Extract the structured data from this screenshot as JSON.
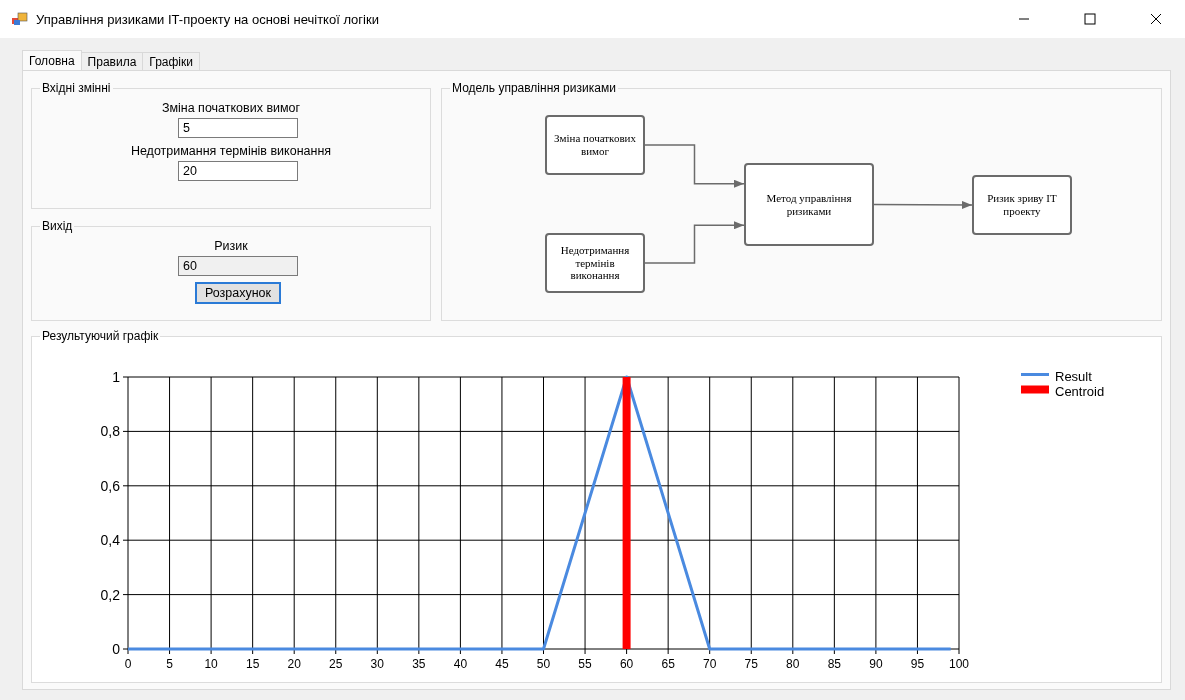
{
  "window": {
    "title": "Управління ризиками IT-проекту на основі нечіткої логіки"
  },
  "tabs": [
    {
      "label": "Головна",
      "selected": true
    },
    {
      "label": "Правила",
      "selected": false
    },
    {
      "label": "Графіки",
      "selected": false
    }
  ],
  "inputs": {
    "title": "Вхідні змінні",
    "fields": [
      {
        "label": "Зміна початкових вимог",
        "value": "5"
      },
      {
        "label": "Недотримання термінів виконання",
        "value": "20"
      }
    ]
  },
  "output": {
    "title": "Вихід",
    "label": "Ризик",
    "value": "60",
    "disabled": true,
    "button": "Розрахунок"
  },
  "model": {
    "title": "Модель управління ризиками",
    "nodes": [
      "Зміна початкових вимог",
      "Недотримання термінів виконання",
      "Метод управління ризиками",
      "Ризик зриву IT проекту"
    ]
  },
  "result": {
    "title": "Результуючий графік",
    "chart_data": {
      "type": "line",
      "x": [
        0,
        50,
        60,
        60,
        70,
        99
      ],
      "series": [
        {
          "name": "Result",
          "color": "#4a8ae0",
          "values": [
            0,
            0,
            1,
            1,
            0,
            0
          ]
        },
        {
          "name": "Centroid",
          "color": "#ff0000",
          "values": [
            null,
            null,
            0,
            1,
            null,
            null
          ]
        }
      ],
      "grid": true,
      "legend": "right",
      "xlim": [
        0,
        100
      ],
      "ylim": [
        0,
        1
      ],
      "xticks": [
        0,
        5,
        10,
        15,
        20,
        25,
        30,
        35,
        40,
        45,
        50,
        55,
        60,
        65,
        70,
        75,
        80,
        85,
        90,
        95,
        100
      ],
      "yticks": [
        {
          "value": 0,
          "label": "0"
        },
        {
          "value": 0.2,
          "label": "0,2"
        },
        {
          "value": 0.4,
          "label": "0,4"
        },
        {
          "value": 0.6,
          "label": "0,6"
        },
        {
          "value": 0.8,
          "label": "0,8"
        },
        {
          "value": 1,
          "label": "1"
        }
      ]
    }
  }
}
